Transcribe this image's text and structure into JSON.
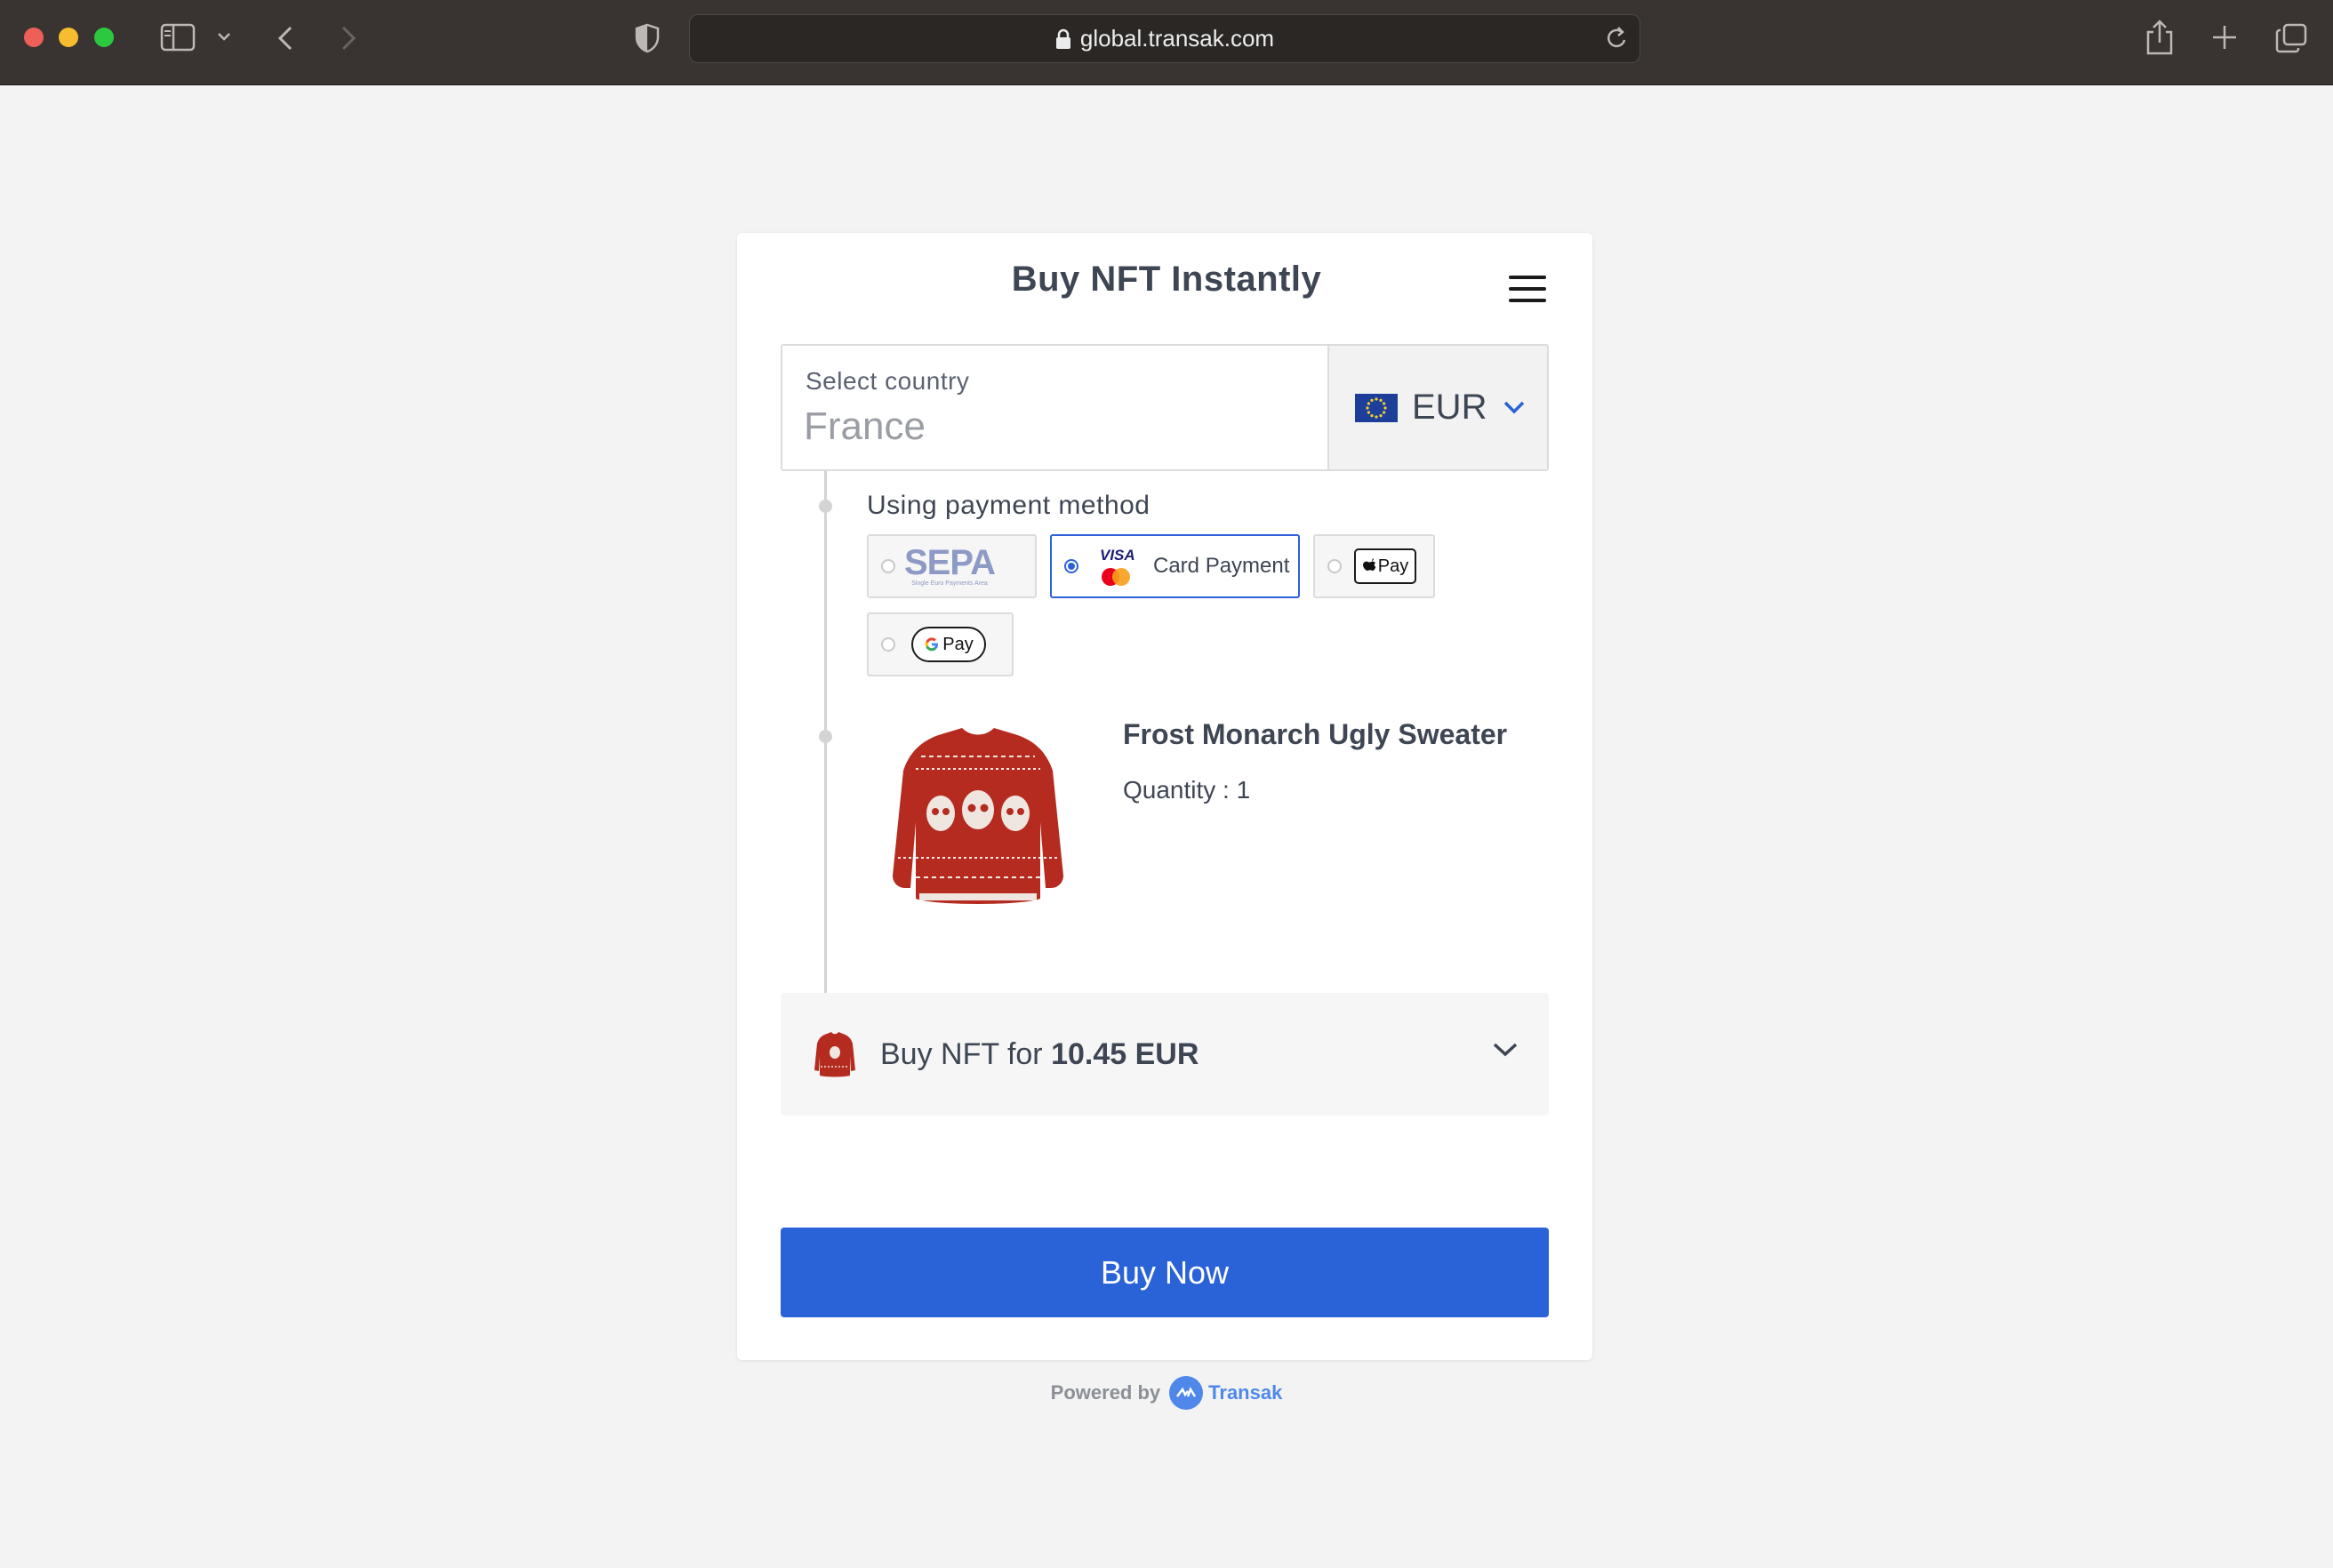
{
  "browser": {
    "url": "global.transak.com"
  },
  "widget": {
    "title": "Buy NFT Instantly",
    "country": {
      "label": "Select country",
      "value": "France"
    },
    "currency": {
      "code": "EUR",
      "flag": "eu-flag"
    },
    "payment": {
      "label": "Using payment method",
      "methods": [
        {
          "id": "sepa",
          "label": "SEPA",
          "sublabel": "Single Euro Payments Area",
          "selected": false
        },
        {
          "id": "card",
          "label": "Card Payment",
          "logo": "VISA",
          "selected": true
        },
        {
          "id": "apple",
          "label": "Pay",
          "selected": false
        },
        {
          "id": "google",
          "label": "Pay",
          "selected": false
        }
      ]
    },
    "nft": {
      "name": "Frost Monarch Ugly Sweater",
      "quantity": "Quantity : 1"
    },
    "summary": {
      "prefix": "Buy NFT for",
      "amount": "10.45 EUR"
    },
    "buy_button": "Buy Now",
    "powered": {
      "label": "Powered by",
      "brand": "Transak"
    }
  },
  "colors": {
    "accent": "#2a62d7",
    "text": "#3e4654",
    "sweater": "#b52b20"
  }
}
